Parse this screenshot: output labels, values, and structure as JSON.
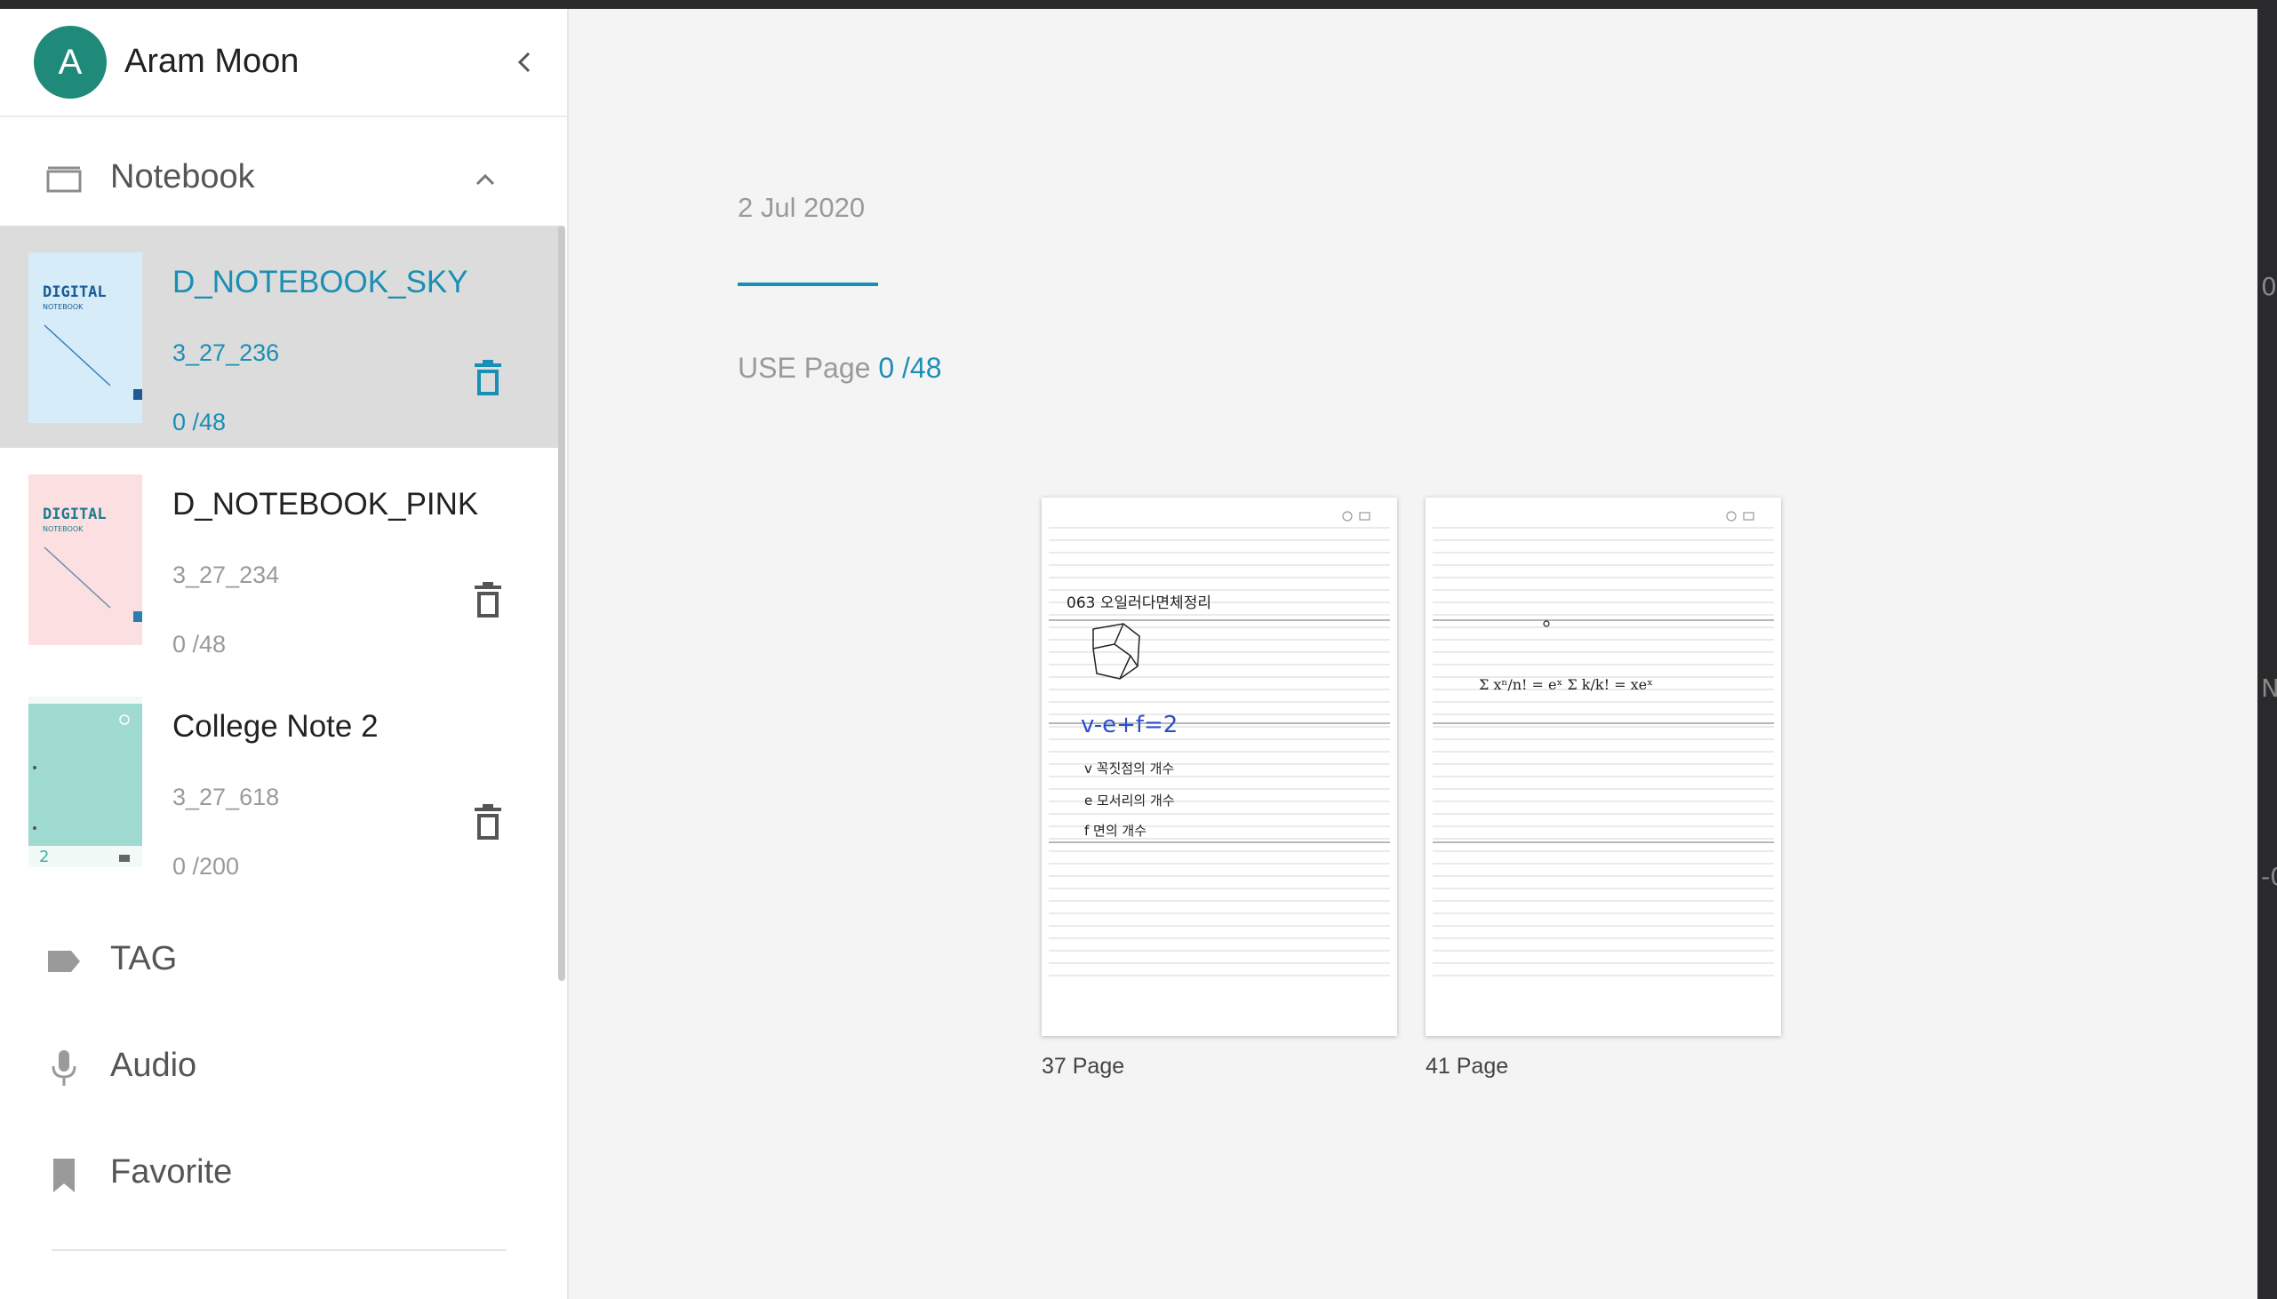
{
  "user": {
    "initial": "A",
    "name": "Aram Moon"
  },
  "sidebar": {
    "notebook_section": {
      "label": "Notebook",
      "icon": "notebook-icon",
      "expanded": true
    },
    "notebooks": [
      {
        "title": "D_NOTEBOOK_SKY",
        "code": "3_27_236",
        "pages": "0 /48",
        "selected": true,
        "cover_color": "#d6ecf8",
        "cover_text": "DIGITAL",
        "cover_subtext": "NOTEBOOK"
      },
      {
        "title": "D_NOTEBOOK_PINK",
        "code": "3_27_234",
        "pages": "0 /48",
        "selected": false,
        "cover_color": "#fbdfe1",
        "cover_text": "DIGITAL",
        "cover_subtext": "NOTEBOOK"
      },
      {
        "title": "College Note 2",
        "code": "3_27_618",
        "pages": "0 /200",
        "selected": false,
        "cover_color": "#9fdbd1",
        "cover_number": "2"
      }
    ],
    "tag_label": "TAG",
    "audio_label": "Audio",
    "favorite_label": "Favorite"
  },
  "main": {
    "date": "2 Jul 2020",
    "use_page_label": "USE Page",
    "use_page_count": "0 /48",
    "pages": [
      {
        "label": "37 Page",
        "handwriting": [
          "063 오일러다면체정리",
          "v-e+f=2",
          "v 꼭짓점의 개수",
          "e 모서리의 개수",
          "f 면의 개수"
        ]
      },
      {
        "label": "41 Page",
        "handwriting": [
          "Σ xⁿ/n! = eˣ   Σ k/k! = xeˣ"
        ]
      }
    ]
  },
  "colors": {
    "accent": "#1a8fb5",
    "avatar": "#1f8a7a",
    "selected_bg": "#dcdcdc"
  },
  "edge_marks": [
    "0",
    "N",
    "-0"
  ]
}
